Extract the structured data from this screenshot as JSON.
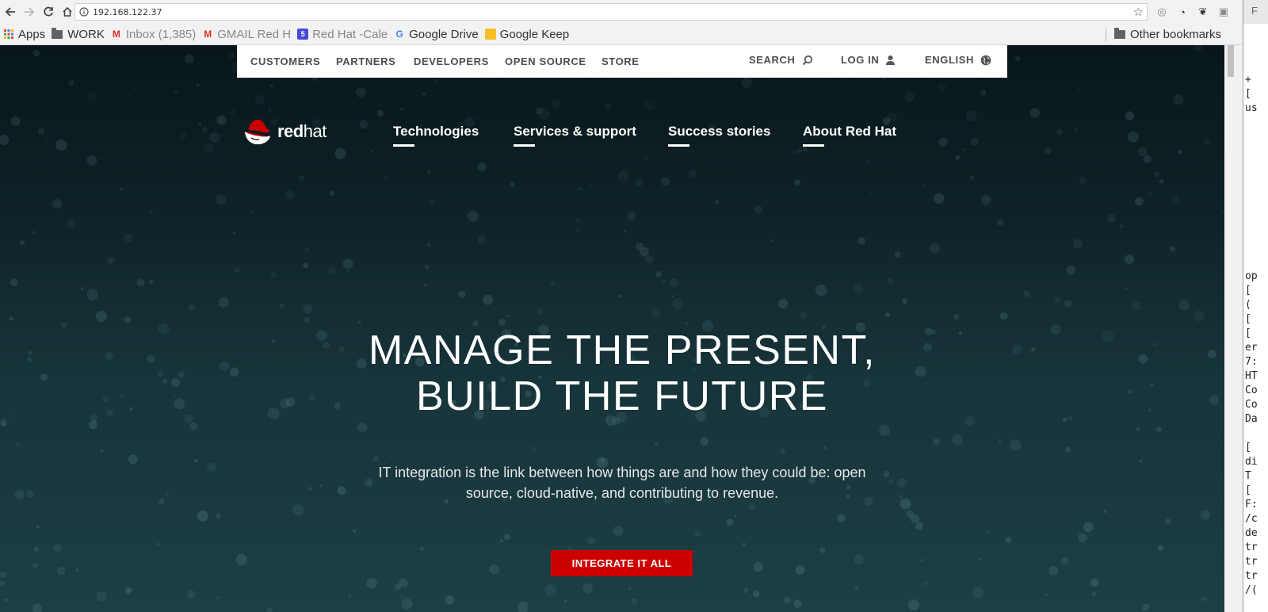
{
  "browser": {
    "url": "192.168.122.37",
    "bookmarks": [
      {
        "label": "Apps",
        "icon": "apps-grid-icon"
      },
      {
        "label": "WORK",
        "icon": "folder-icon"
      },
      {
        "label": "Inbox (1,385)",
        "icon": "gmail-icon"
      },
      {
        "label": "GMAIL Red H",
        "icon": "gmail-icon"
      },
      {
        "label": "Red Hat -Cale",
        "icon": "calendar-icon"
      },
      {
        "label": "Google Drive",
        "icon": "google-icon"
      },
      {
        "label": "Google Keep",
        "icon": "keep-icon"
      }
    ],
    "other_bookmarks": "Other bookmarks"
  },
  "utility_nav": {
    "customers": "CUSTOMERS",
    "partners": "PARTNERS",
    "developers": "DEVELOPERS",
    "open_source": "OPEN SOURCE",
    "store": "STORE",
    "search": "SEARCH",
    "login": "LOG IN",
    "language": "ENGLISH"
  },
  "logo": {
    "bold": "red",
    "light": "hat"
  },
  "main_nav": {
    "technologies": "Technologies",
    "services": "Services & support",
    "success": "Success stories",
    "about": "About Red Hat"
  },
  "hero": {
    "title_line1": "MANAGE THE PRESENT,",
    "title_line2": "BUILD THE FUTURE",
    "subtitle_line1": "IT integration is the link between how things are and how they could be: open",
    "subtitle_line2": "source, cloud-native, and contributing to revenue.",
    "cta": "INTEGRATE IT ALL"
  },
  "terminal": {
    "top_label": "F",
    "lines": [
      "+",
      "[",
      "us",
      "op",
      "[",
      "(",
      "[",
      "[",
      "er",
      "7:",
      "HT",
      "Co",
      "Co",
      "Da",
      "[",
      "di",
      "T",
      "[",
      "F:",
      "/c",
      "de",
      "tr",
      "tr",
      "tr",
      "/("
    ]
  },
  "colors": {
    "accent": "#cc0000",
    "utility_bg": "#ffffff",
    "hero_bg_top": "#081619",
    "hero_bg_bottom": "#1c3e44"
  }
}
